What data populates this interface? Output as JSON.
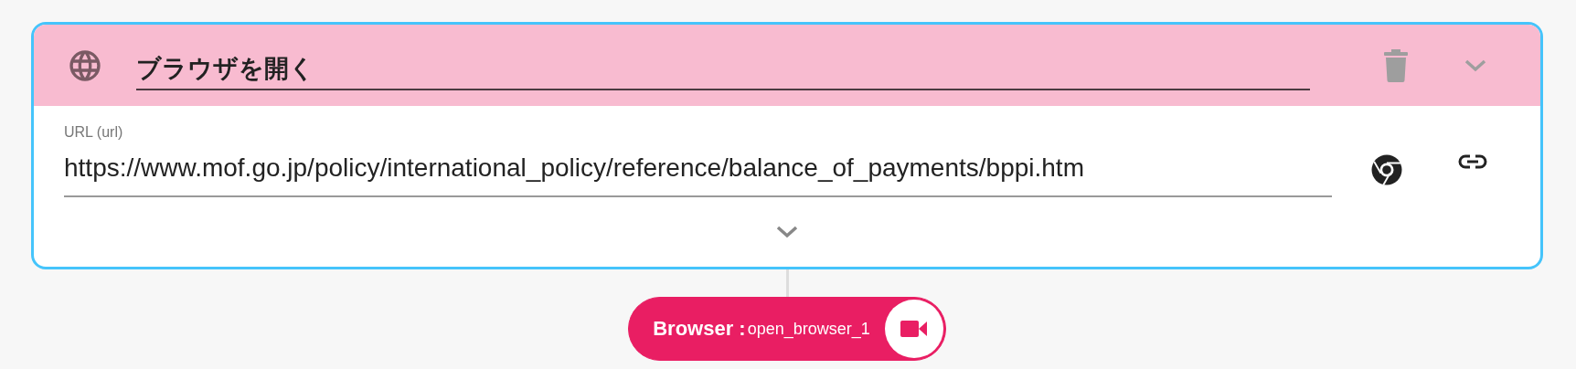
{
  "card": {
    "title": "ブラウザを開く",
    "expanded": true,
    "fields": [
      {
        "label": "URL (url)",
        "value": "https://www.mof.go.jp/policy/international_policy/reference/balance_of_payments/bppi.htm"
      }
    ]
  },
  "output": {
    "type_label": "Browser :",
    "variable": "open_browser_1"
  }
}
